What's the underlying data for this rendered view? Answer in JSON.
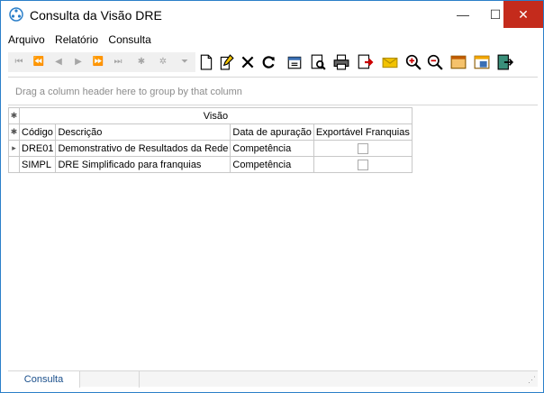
{
  "window": {
    "title": "Consulta da Visão DRE",
    "min": "—",
    "max": "☐",
    "close": "✕"
  },
  "menu": [
    {
      "label": "Arquivo"
    },
    {
      "label": "Relatório"
    },
    {
      "label": "Consulta"
    }
  ],
  "toolbar": {
    "nav": [
      "⏮",
      "⏪",
      "◀",
      "▶",
      "⏩",
      "⏭",
      "✱",
      "✲",
      "⏷"
    ],
    "actions": [
      "new-icon",
      "edit-icon",
      "delete-icon",
      "refresh-icon",
      "properties-icon",
      "preview-icon",
      "print-icon",
      "export-icon",
      "email-icon",
      "zoom-in-icon",
      "zoom-out-icon",
      "calendar-icon",
      "window-icon",
      "exit-icon"
    ]
  },
  "grouppanel": {
    "text": "Drag a column header here to group by that column"
  },
  "grid": {
    "band": "Visão",
    "columns": [
      "Código",
      "Descrição",
      "Data de apuração",
      "Exportável Franquias"
    ],
    "rows": [
      {
        "codigo": "DRE01",
        "descricao": "Demonstrativo de Resultados da Rede",
        "data": "Competência",
        "exportavel": false
      },
      {
        "codigo": "SIMPL",
        "descricao": "DRE Simplificado para franquias",
        "data": "Competência",
        "exportavel": false
      }
    ]
  },
  "status": {
    "tab": "Consulta"
  }
}
